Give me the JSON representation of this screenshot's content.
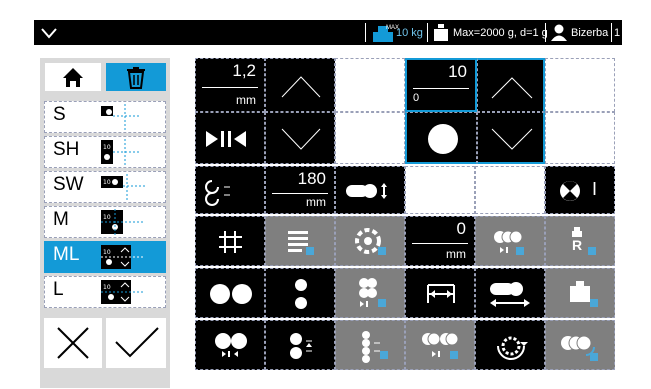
{
  "topbar": {
    "tare_label": "10 kg",
    "tare_badge": "MAX",
    "scale_info": "Max=2000 g, d=1 g",
    "user": "Bizerba",
    "page": "1"
  },
  "left_menu": {
    "items": [
      {
        "label": "S"
      },
      {
        "label": "SH"
      },
      {
        "label": "SW"
      },
      {
        "label": "M"
      },
      {
        "label": "ML",
        "selected": true
      },
      {
        "label": "L"
      }
    ],
    "mini_badge": "10"
  },
  "grid": {
    "thickness": {
      "value": "1,2",
      "unit": "mm"
    },
    "count": {
      "value": "10",
      "min": "0"
    },
    "distance": {
      "value": "180",
      "unit": "mm"
    },
    "offset": {
      "value": "0",
      "unit": "mm"
    },
    "toggle_label": "I",
    "r_label": "R"
  },
  "colors": {
    "accent": "#139ad7",
    "tile_dark": "#000000",
    "tile_gray": "#7f7f7f",
    "sub_icon": "#4aa7d8"
  }
}
